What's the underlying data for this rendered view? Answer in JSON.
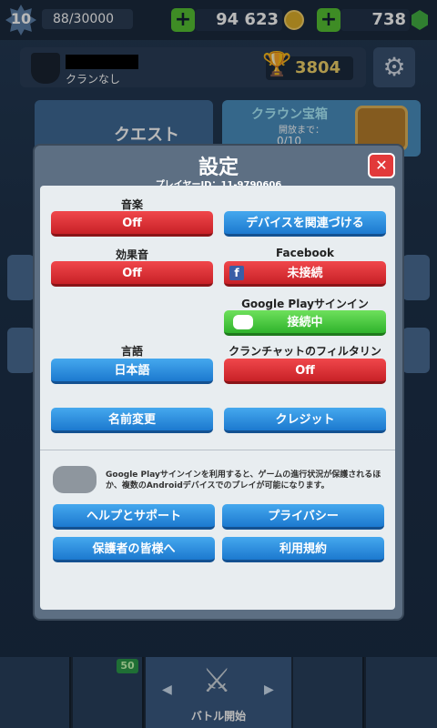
{
  "topbar": {
    "level": "10",
    "xp": "88/30000",
    "plus_gold": "+",
    "gold": "94 623",
    "plus_gems": "+",
    "gems": "738"
  },
  "profile": {
    "clan": "クランなし",
    "trophies": "3804"
  },
  "background": {
    "quest_label": "クエスト",
    "crown_title": "クラウン宝箱",
    "crown_sub": "開放まで：",
    "crown_progress": "0/10"
  },
  "nav": {
    "badge": "50",
    "battle_label": "バトル開始"
  },
  "modal": {
    "title": "設定",
    "player_id": "プレイヤーID：11-9790606",
    "close": "✕",
    "music_label": "音楽",
    "music_value": "Off",
    "sfx_label": "効果音",
    "sfx_value": "Off",
    "link_device": "デバイスを関連づける",
    "facebook_label": "Facebook",
    "facebook_value": "未接続",
    "gplay_label": "Google Playサインイン",
    "gplay_value": "接続中",
    "language_label": "言語",
    "language_value": "日本語",
    "clanfilter_label": "クランチャットのフィルタリング",
    "clanfilter_value": "Off",
    "rename": "名前変更",
    "credits": "クレジット",
    "note": "Google Playサインインを利用すると、ゲームの進行状況が保護されるほか、複数のAndroidデバイスでのプレイが可能になります。",
    "help": "ヘルプとサポート",
    "privacy": "プライバシー",
    "parents": "保護者の皆様へ",
    "terms": "利用規約"
  },
  "colors": {
    "red_button": "#d9302f",
    "blue_button": "#2a8ee0",
    "green_button": "#44c43a",
    "panel": "#e8edf0"
  }
}
